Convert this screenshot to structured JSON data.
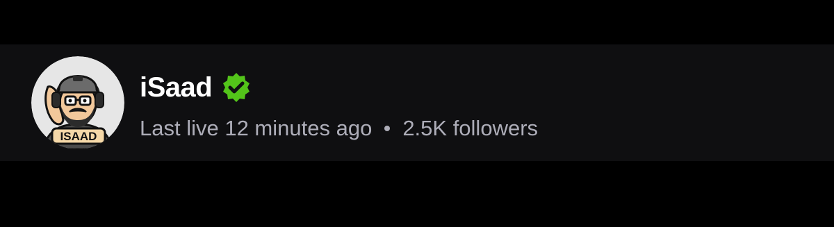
{
  "channel": {
    "name": "iSaad",
    "avatar_text": "ISAAD",
    "verified_icon": "verified-badge-icon",
    "verified_color": "#53c41a",
    "last_live": "Last live 12 minutes ago",
    "separator": "•",
    "followers": "2.5K followers"
  },
  "colors": {
    "background": "#000000",
    "card": "#0f0f11",
    "name": "#ffffff",
    "meta": "#adadb8"
  }
}
